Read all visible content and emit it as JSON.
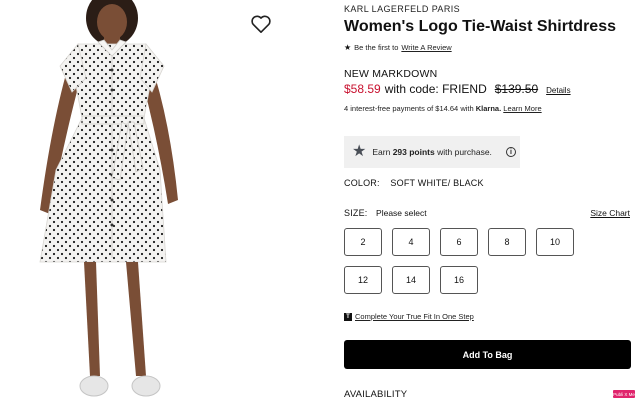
{
  "product": {
    "brand": "KARL LAGERFELD PARIS",
    "title": "Women's Logo Tie-Waist Shirtdress",
    "review_prefix": "Be the first to",
    "review_link": "Write A Review"
  },
  "pricing": {
    "markdown_label": "NEW MARKDOWN",
    "sale_price": "$58.59",
    "code_text": "with code: FRIEND",
    "original_price": "$139.50",
    "details_link": "Details",
    "klarna_text": "4 interest-free payments of $14.64 with",
    "klarna_brand": "Klarna.",
    "learn_more": "Learn More",
    "sale_color": "#c8102e"
  },
  "points": {
    "prefix": "Earn",
    "amount": "293 points",
    "suffix": "with purchase."
  },
  "color": {
    "label": "COLOR:",
    "value": "SOFT WHITE/ BLACK"
  },
  "size": {
    "label": "SIZE:",
    "prompt": "Please select",
    "chart_link": "Size Chart",
    "options": [
      "2",
      "4",
      "6",
      "8",
      "10",
      "12",
      "14",
      "16"
    ]
  },
  "fit": {
    "link": "Complete Your True Fit In One Step"
  },
  "cart": {
    "add_label": "Add To Bag"
  },
  "availability": {
    "label": "AVAILABILITY"
  },
  "badge": {
    "label": "Publi X Me"
  },
  "icons": {
    "wishlist": "heart-icon",
    "review": "star-icon",
    "points": "star-icon",
    "info": "info-icon",
    "fit": "truefit-icon"
  }
}
